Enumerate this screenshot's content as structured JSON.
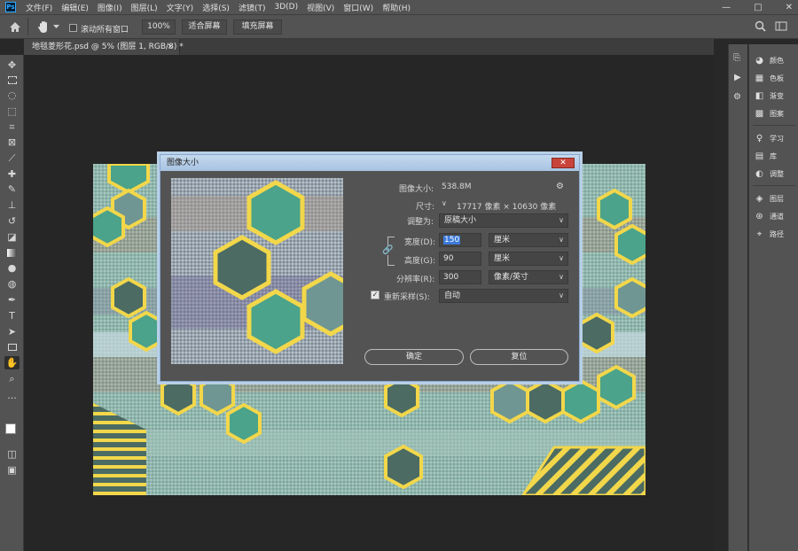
{
  "menu": {
    "logo": "Ps",
    "items": [
      "文件(F)",
      "编辑(E)",
      "图像(I)",
      "图层(L)",
      "文字(Y)",
      "选择(S)",
      "滤镜(T)",
      "3D(D)",
      "视图(V)",
      "窗口(W)",
      "帮助(H)"
    ],
    "minimize": "—",
    "maximize": "□",
    "close": "✕"
  },
  "options": {
    "scroll_all_label": "滚动所有窗口",
    "zoom_value": "100%",
    "fit_screen_label": "适合屏幕",
    "fill_screen_label": "填充屏幕"
  },
  "tab": {
    "title": "地毯菱形花.psd @ 5% (图层 1, RGB/8) *",
    "close": "×"
  },
  "panels": {
    "items": [
      {
        "icon": "palette-icon",
        "label": "颜色"
      },
      {
        "icon": "swatches-icon",
        "label": "色板"
      },
      {
        "icon": "gradient-icon",
        "label": "渐变"
      },
      {
        "icon": "patterns-icon",
        "label": "图案"
      },
      {
        "icon": "learn-icon",
        "label": "学习"
      },
      {
        "icon": "libraries-icon",
        "label": "库"
      },
      {
        "icon": "adjustments-icon",
        "label": "调整"
      },
      {
        "icon": "layers-icon",
        "label": "图层"
      },
      {
        "icon": "channels-icon",
        "label": "通道"
      },
      {
        "icon": "paths-icon",
        "label": "路径"
      }
    ]
  },
  "dialog": {
    "title": "图像大小",
    "close": "✕",
    "image_size_label": "图像大小:",
    "image_size_value": "538.8M",
    "dimensions_label": "尺寸:",
    "dimensions_value": "17717 像素  ×  10630 像素",
    "fit_to_label": "调整为:",
    "fit_to_value": "原稿大小",
    "width_label": "宽度(D):",
    "width_value": "150",
    "width_unit": "厘米",
    "height_label": "高度(G):",
    "height_value": "90",
    "height_unit": "厘米",
    "resolution_label": "分辨率(R):",
    "resolution_value": "300",
    "resolution_unit": "像素/英寸",
    "resample_label": "重新采样(S):",
    "resample_value": "自动",
    "ok_label": "确定",
    "reset_label": "复位"
  },
  "colors": {
    "hex_fill_teal": "#4aa38a",
    "hex_fill_dark": "#4b6b63",
    "hex_fill_gray": "#6f9692",
    "hex_stroke": "#f2d74a",
    "dialog_title_bg": "#b8cfe6"
  }
}
